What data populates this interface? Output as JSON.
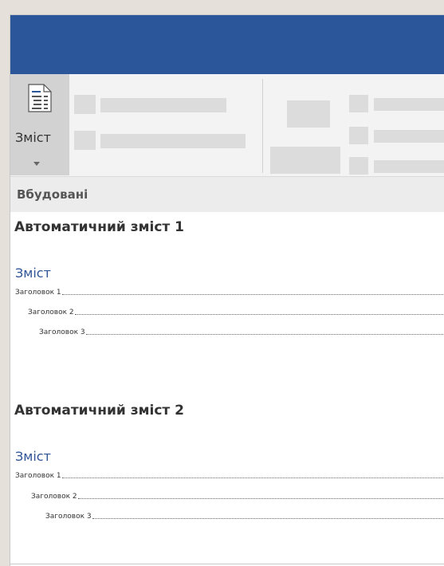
{
  "ribbon": {
    "toc_button_label": "Зміст"
  },
  "gallery": {
    "section_label": "Вбудовані",
    "items": [
      {
        "title": "Автоматичний зміст 1",
        "heading": "Зміст",
        "entries": [
          "Заголовок 1",
          "Заголовок 2",
          "Заголовок 3"
        ]
      },
      {
        "title": "Автоматичний зміст 2",
        "heading": "Зміст",
        "entries": [
          "Заголовок 1",
          "Заголовок 2",
          "Заголовок 3"
        ]
      }
    ]
  },
  "colors": {
    "titlebar": "#2b579a",
    "toc_heading": "#2f5496",
    "ribbon_bg": "#f3f3f3",
    "button_selected": "#d2d2d2"
  },
  "icons": {
    "toc_button": "document-lines-icon",
    "dropdown": "caret-down-icon"
  }
}
